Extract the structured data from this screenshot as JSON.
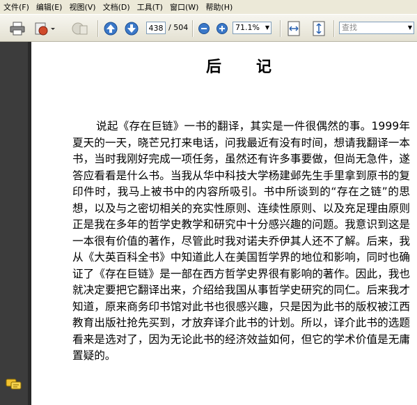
{
  "menu": [
    "文件(F)",
    "编辑(E)",
    "视图(V)",
    "文档(D)",
    "工具(T)",
    "窗口(W)",
    "帮助(H)"
  ],
  "toolbar": {
    "current_page": "438",
    "page_total": "/ 504",
    "zoom": "71.1%",
    "search_placeholder": "查找",
    "icons": [
      "printer-icon",
      "email-icon",
      "review-icon",
      "page-up-icon",
      "page-down-icon",
      "zoom-out-icon",
      "zoom-in-icon",
      "fit-width-icon",
      "fit-page-icon"
    ]
  },
  "document": {
    "title": "后记",
    "paragraph": "说起《存在巨链》一书的翻译，其实是一件很偶然的事。1999年夏天的一天，晓芒兄打来电话，问我最近有没有时间，想请我翻译一本书，当时我刚好完成一项任务，虽然还有许多事要做，但尚无急件，遂答应看看是什么书。当我从华中科技大学杨建邺先生手里拿到原书的复印件时，我马上被书中的内容所吸引。书中所谈到的“存在之链”的思想，以及与之密切相关的充实性原则、连续性原则、以及充足理由原则正是我在多年的哲学史教学和研究中十分感兴趣的问题。我意识到这是一本很有价值的著作，尽管此时我对诺夫乔伊其人还不了解。后来，我从《大英百科全书》中知道此人在美国哲学界的地位和影响，同时也确证了《存在巨链》是一部在西方哲学史界很有影响的著作。因此，我也就决定要把它翻译出来，介绍给我国从事哲学史研究的同仁。后来我才知道，原来商务印书馆对此书也很感兴趣，只是因为此书的版权被江西教育出版社抢先买到，才放弃译介此书的计划。所以，译介此书的选题看来是选对了，因为无论此书的经济效益如何，但它的学术价值是无庸置疑的。"
  }
}
